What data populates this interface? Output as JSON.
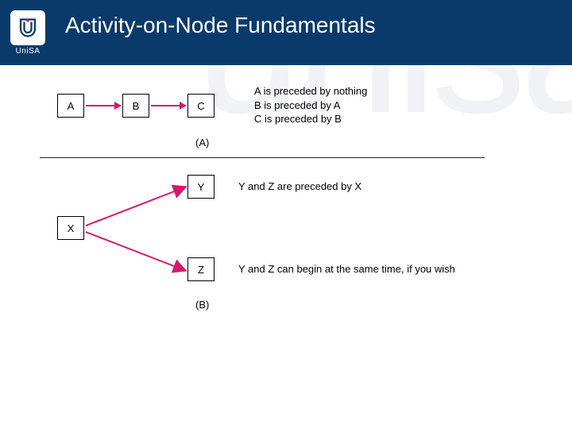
{
  "brand": {
    "name": "UniSA",
    "watermark": "unisa"
  },
  "title": "Activity-on-Node Fundamentals",
  "diagram": {
    "A": {
      "nodes": {
        "a": "A",
        "b": "B",
        "c": "C"
      },
      "desc_lines": {
        "l1": "A is preceded by nothing",
        "l2": "B is preceded by A",
        "l3": "C is preceded by B"
      },
      "caption": "(A)"
    },
    "B": {
      "nodes": {
        "x": "X",
        "y": "Y",
        "z": "Z"
      },
      "desc_lines": {
        "l1": "Y and Z are preceded by X",
        "l2": "Y and Z can begin at the same time, if you wish"
      },
      "caption": "(B)"
    }
  },
  "chart_data": {
    "type": "diagram",
    "title": "Activity-on-Node Fundamentals",
    "panels": [
      {
        "label": "(A)",
        "nodes": [
          "A",
          "B",
          "C"
        ],
        "edges": [
          [
            "A",
            "B"
          ],
          [
            "B",
            "C"
          ]
        ],
        "notes": [
          "A is preceded by nothing",
          "B is preceded by A",
          "C is preceded by B"
        ]
      },
      {
        "label": "(B)",
        "nodes": [
          "X",
          "Y",
          "Z"
        ],
        "edges": [
          [
            "X",
            "Y"
          ],
          [
            "X",
            "Z"
          ]
        ],
        "notes": [
          "Y and Z are preceded by X",
          "Y and Z can begin at the same time, if you wish"
        ]
      }
    ]
  }
}
